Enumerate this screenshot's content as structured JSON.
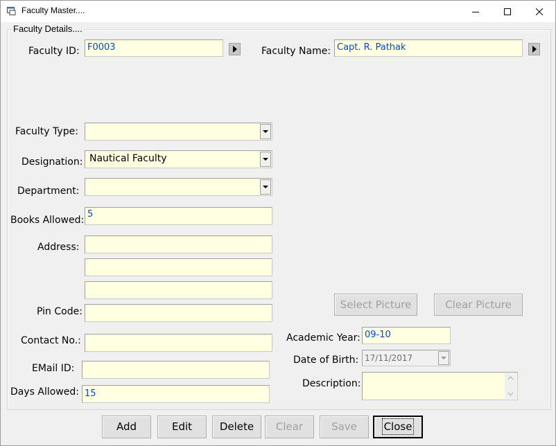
{
  "window": {
    "title": "Faculty Master....",
    "icon": "form-window-icon",
    "controls": [
      "minimize-icon",
      "maximize-icon",
      "close-icon"
    ]
  },
  "group": {
    "legend": "Faculty Details...."
  },
  "labels": {
    "faculty_id": "Faculty ID:",
    "faculty_name": "Faculty Name:",
    "faculty_type": "Faculty Type:",
    "designation": "Designation:",
    "department": "Department:",
    "books_allowed": "Books Allowed:",
    "address": "Address:",
    "pin_code": "Pin Code:",
    "contact_no": "Contact No.:",
    "email_id": "EMail ID:",
    "days_allowed": "Days Allowed:",
    "academic_year": "Academic Year:",
    "date_of_birth": "Date of Birth:",
    "description": "Description:"
  },
  "values": {
    "faculty_id": "F0003",
    "faculty_name": "Capt. R. Pathak",
    "faculty_type": "",
    "designation": "Nautical Faculty",
    "department": "",
    "books_allowed": "5",
    "address1": "",
    "address2": "",
    "address3": "",
    "pin_code": "",
    "contact_no": "",
    "email_id": "",
    "days_allowed": "15",
    "academic_year": "09-10",
    "date_of_birth": "17/11/2017",
    "description": ""
  },
  "picture_buttons": {
    "select": "Select Picture",
    "clear": "Clear Picture"
  },
  "actions": {
    "add": "Add",
    "edit": "Edit",
    "delete": "Delete",
    "clear": "Clear",
    "save": "Save",
    "close": "Close"
  },
  "colors": {
    "field_bg": "#ffffe1",
    "value_text": "#0a46c8",
    "window_bg": "#f0f0f0",
    "disabled_text": "#a0a0a0"
  }
}
